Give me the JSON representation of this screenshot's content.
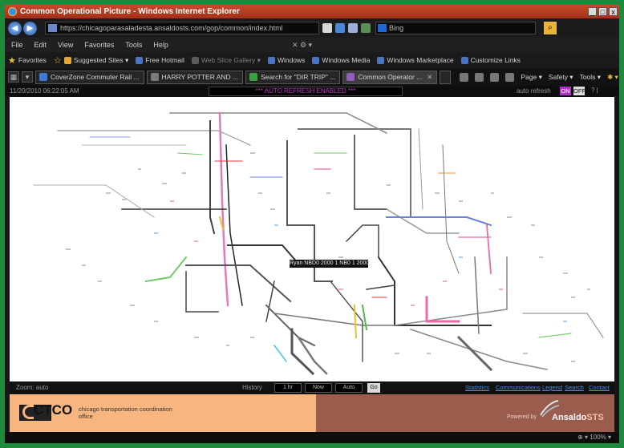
{
  "window": {
    "title": "Common Operational Picture - Windows Internet Explorer",
    "minimize": "_",
    "maximize": "□",
    "close": "x"
  },
  "address": {
    "url": "https://chicagoparasaladesta.ansaldosts.com/gop/common/index.html",
    "search_placeholder": "Bing"
  },
  "menu": [
    "File",
    "Edit",
    "View",
    "Favorites",
    "Tools",
    "Help"
  ],
  "favorites": {
    "label": "Favorites",
    "items": [
      {
        "label": "Suggested Sites ▾",
        "dim": false
      },
      {
        "label": "Free Hotmail",
        "dim": false
      },
      {
        "label": "Web Slice Gallery ▾",
        "dim": true
      },
      {
        "label": "Windows",
        "dim": false
      },
      {
        "label": "Windows Media",
        "dim": false
      },
      {
        "label": "Windows Marketplace",
        "dim": false
      },
      {
        "label": "Customize Links",
        "dim": false
      }
    ]
  },
  "tabs": {
    "items": [
      {
        "label": "CoverZone Commuter Rail ...",
        "active": false,
        "icon_color": "#3a7bd5"
      },
      {
        "label": "HARRY POTTER AND ...",
        "active": false,
        "icon_color": "#7a7a7a"
      },
      {
        "label": "Search for \"DIR TRIP\" ...",
        "active": false,
        "icon_color": "#3aa040"
      },
      {
        "label": "Common Operator ...",
        "active": true,
        "icon_color": "#8f5fbf"
      }
    ],
    "commands": [
      "Page ▾",
      "Safety ▾",
      "Tools ▾"
    ]
  },
  "page": {
    "timestamp": "11/20/2010 06:22:05 AM",
    "refresh_banner": "*** AUTO REFRESH ENABLED ***",
    "auto_refresh_label": "auto refresh",
    "on_label": "ON",
    "off_label": "OFF",
    "misc": "? |"
  },
  "map": {
    "tooltip": "Ryan  NBD0 2000 1 NB0 1 2000"
  },
  "footer": {
    "zoom_label": "Zoom: auto",
    "history_label": "History",
    "fields": [
      "1 hr",
      "Now",
      "Auto"
    ],
    "go_label": "Go",
    "links": [
      "Statistics",
      "Communications",
      "Legend",
      "Search",
      "Contact"
    ]
  },
  "branding": {
    "ctco_wordmark": "CTCO",
    "ctco_tagline": "chicago transportation coordination office",
    "powered_by": "Powered by",
    "ansaldo": "Ansaldo",
    "sts": "STS"
  },
  "status": {
    "zoom": "⊕ ▾  100% ▾"
  },
  "colors": {
    "border_green": "#1e8a3c",
    "title_red": "#c84a2c",
    "branding_peach": "#f7b580",
    "branding_brown": "#9a5c4c",
    "refresh_magenta": "#c832c8"
  }
}
